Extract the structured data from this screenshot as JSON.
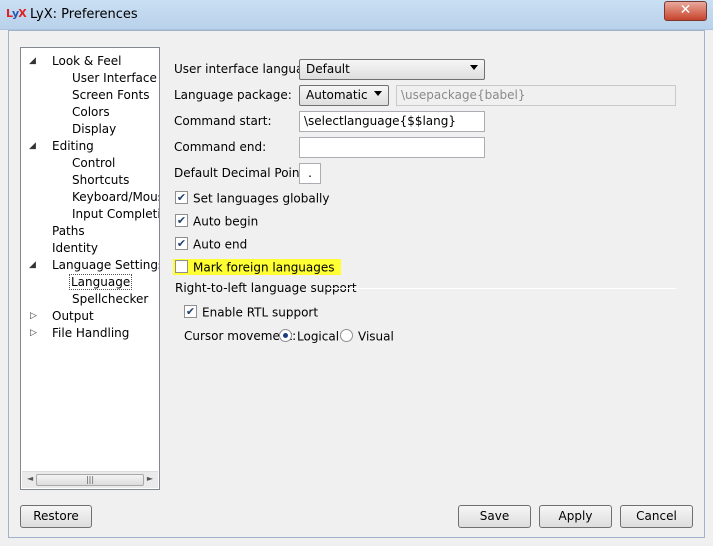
{
  "window": {
    "title": "LyX: Preferences",
    "app_icon": "LyX",
    "close_glyph": "✕"
  },
  "tree": {
    "items": [
      {
        "label": "Look & Feel",
        "level": 0,
        "expanded": true
      },
      {
        "label": "User Interface",
        "level": 1
      },
      {
        "label": "Screen Fonts",
        "level": 1
      },
      {
        "label": "Colors",
        "level": 1
      },
      {
        "label": "Display",
        "level": 1
      },
      {
        "label": "Editing",
        "level": 0,
        "expanded": true
      },
      {
        "label": "Control",
        "level": 1
      },
      {
        "label": "Shortcuts",
        "level": 1
      },
      {
        "label": "Keyboard/Mouse",
        "level": 1
      },
      {
        "label": "Input Completion",
        "level": 1
      },
      {
        "label": "Paths",
        "level": 0
      },
      {
        "label": "Identity",
        "level": 0
      },
      {
        "label": "Language Settings",
        "level": 0,
        "expanded": true
      },
      {
        "label": "Language",
        "level": 1,
        "selected": true
      },
      {
        "label": "Spellchecker",
        "level": 1
      },
      {
        "label": "Output",
        "level": 0,
        "expanded": false
      },
      {
        "label": "File Handling",
        "level": 0,
        "expanded": false
      }
    ],
    "scroll_left": "◄",
    "scroll_right": "►",
    "scroll_grip": "|||"
  },
  "form": {
    "ui_language_label": "User interface language:",
    "ui_language_value": "Default",
    "language_package_label": "Language package:",
    "language_package_value": "Automatic",
    "language_package_text": "\\usepackage{babel}",
    "command_start_label": "Command start:",
    "command_start_value": "\\selectlanguage{$$lang}",
    "command_end_label": "Command end:",
    "command_end_value": "",
    "decimal_point_label": "Default Decimal Point:",
    "decimal_point_value": ".",
    "set_globally_label": "Set languages globally",
    "set_globally_checked": true,
    "auto_begin_label": "Auto begin",
    "auto_begin_checked": true,
    "auto_end_label": "Auto end",
    "auto_end_checked": true,
    "mark_foreign_label": "Mark foreign languages",
    "mark_foreign_checked": false,
    "rtl_group_title": "Right-to-left language support",
    "enable_rtl_label": "Enable RTL support",
    "enable_rtl_checked": true,
    "cursor_movement_label": "Cursor movement:",
    "cursor_logical_label": "Logical",
    "cursor_visual_label": "Visual",
    "cursor_selected": "Logical"
  },
  "buttons": {
    "restore": "Restore",
    "save": "Save",
    "apply": "Apply",
    "cancel": "Cancel"
  },
  "colors": {
    "highlight": "#ffff33",
    "selection_border": "#555555"
  }
}
